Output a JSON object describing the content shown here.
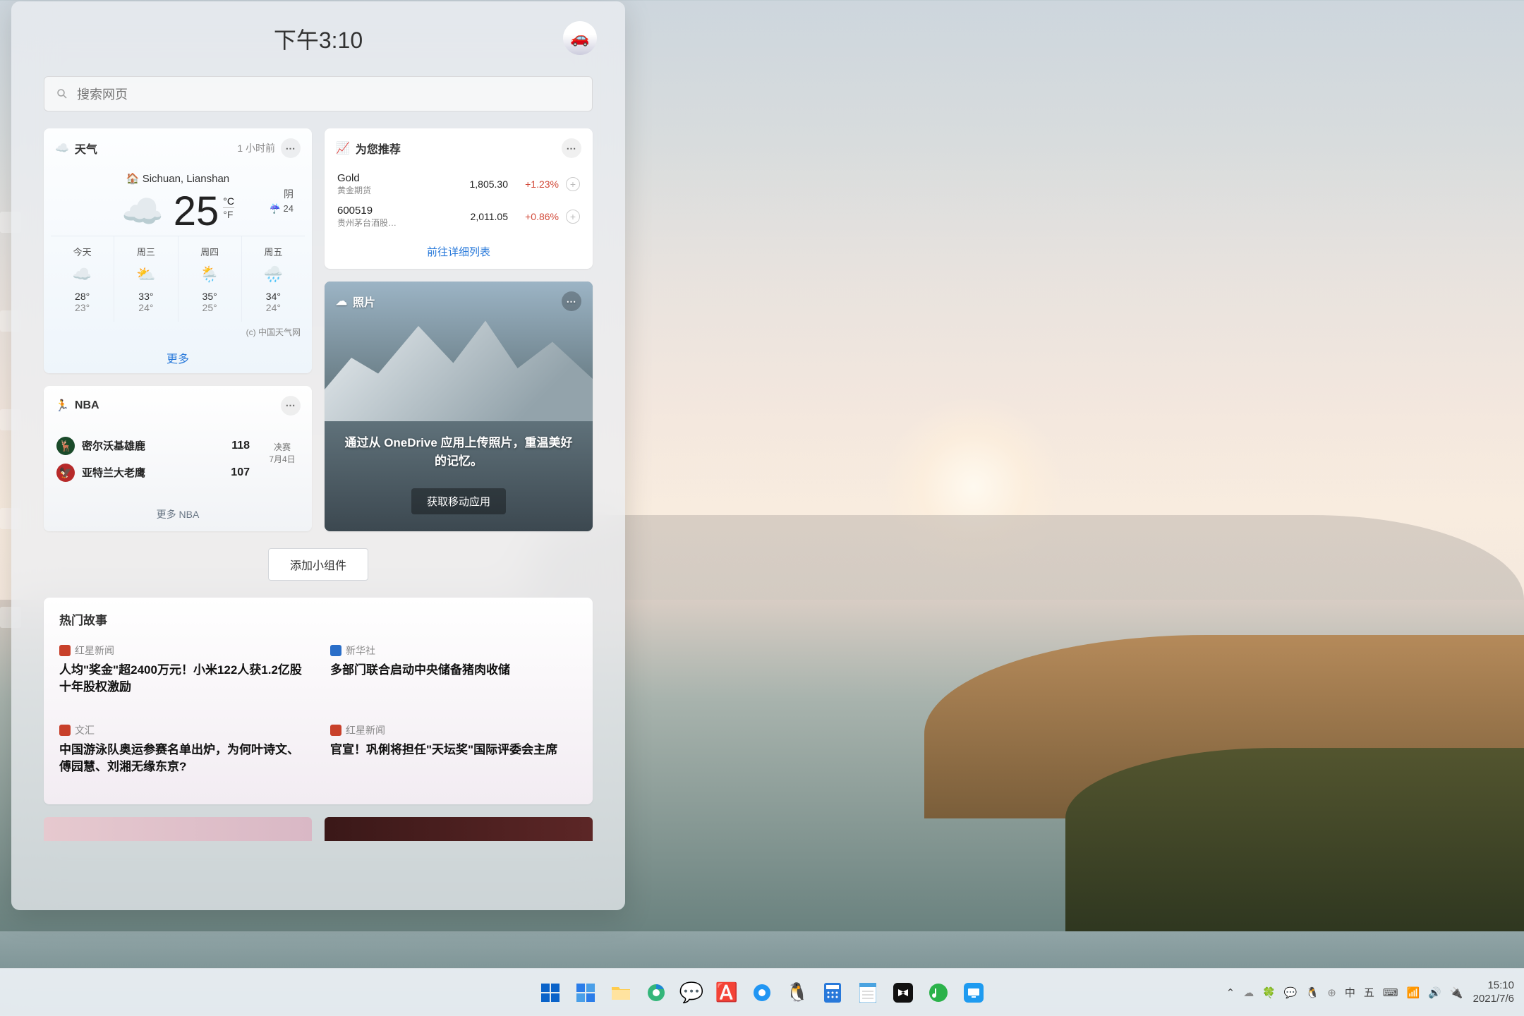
{
  "header": {
    "clock": "下午3:10"
  },
  "search": {
    "placeholder": "搜索网页"
  },
  "weather": {
    "title": "天气",
    "updated": "1 小时前",
    "location": "Sichuan, Lianshan",
    "temp": "25",
    "unit_c": "°C",
    "unit_f": "°F",
    "condition": "阴",
    "humidity_icon": "☔",
    "humidity": "24",
    "forecast": [
      {
        "day": "今天",
        "icon": "☁️",
        "hi": "28°",
        "lo": "23°"
      },
      {
        "day": "周三",
        "icon": "⛅",
        "hi": "33°",
        "lo": "24°"
      },
      {
        "day": "周四",
        "icon": "🌦️",
        "hi": "35°",
        "lo": "25°"
      },
      {
        "day": "周五",
        "icon": "🌧️",
        "hi": "34°",
        "lo": "24°"
      }
    ],
    "credit": "(c) 中国天气网",
    "more": "更多"
  },
  "watchlist": {
    "title": "为您推荐",
    "rows": [
      {
        "symbol": "Gold",
        "name": "黄金期货",
        "price": "1,805.30",
        "change": "+1.23%"
      },
      {
        "symbol": "600519",
        "name": "贵州茅台酒股…",
        "price": "2,011.05",
        "change": "+0.86%"
      }
    ],
    "link": "前往详细列表"
  },
  "photos": {
    "title": "照片",
    "message": "通过从 OneDrive 应用上传照片，重温美好的记忆。",
    "button": "获取移动应用"
  },
  "nba": {
    "title": "NBA",
    "teams": [
      {
        "name": "密尔沃基雄鹿",
        "score": "118"
      },
      {
        "name": "亚特兰大老鹰",
        "score": "107"
      }
    ],
    "stage": "决赛",
    "date": "7月4日",
    "divider": "4",
    "more": "更多 NBA"
  },
  "add_widget": "添加小组件",
  "news": {
    "title": "热门故事",
    "items": [
      {
        "source": "红星新闻",
        "src_color": "#c8402a",
        "headline": "人均\"奖金\"超2400万元！小米122人获1.2亿股十年股权激励"
      },
      {
        "source": "新华社",
        "src_color": "#2a6ec8",
        "headline": "多部门联合启动中央储备猪肉收储"
      },
      {
        "source": "文汇",
        "src_color": "#c8402a",
        "headline": "中国游泳队奥运参赛名单出炉，为何叶诗文、傅园慧、刘湘无缘东京?"
      },
      {
        "source": "红星新闻",
        "src_color": "#c8402a",
        "headline": "官宣！巩俐将担任\"天坛奖\"国际评委会主席"
      }
    ]
  },
  "taskbar": {
    "apps": [
      "start",
      "widgets",
      "explorer",
      "edge",
      "wechat",
      "qq-input",
      "browser",
      "qq",
      "calc",
      "notepad",
      "capcut",
      "music",
      "todesk"
    ],
    "tray": {
      "chevron": "⌃",
      "onedrive": "☁",
      "security": "🛡",
      "wechat_tray": "💬",
      "manager": "🐧",
      "ime_lang": "中",
      "ime_mode": "五",
      "keyboard": "⌨",
      "wifi": "📶",
      "volume": "🔊",
      "power": "🔌"
    },
    "time": "15:10",
    "date": "2021/7/6"
  }
}
